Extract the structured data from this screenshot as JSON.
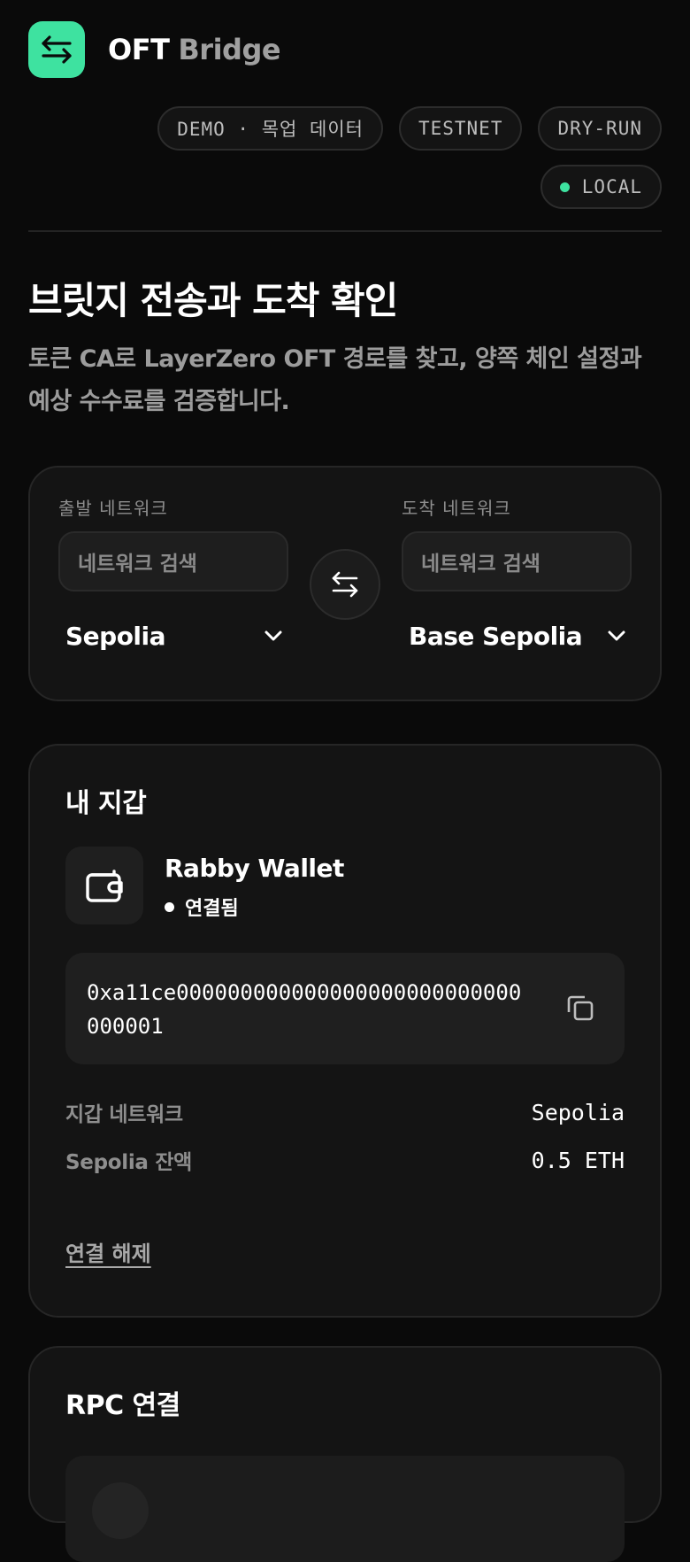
{
  "header": {
    "brand_primary": "OFT",
    "brand_secondary": "Bridge",
    "accent_color": "#3ee2a0"
  },
  "badges": [
    {
      "label": "DEMO · 목업 데이터"
    },
    {
      "label": "TESTNET"
    },
    {
      "label": "DRY-RUN"
    },
    {
      "label": "LOCAL",
      "indicator": "dot-green"
    }
  ],
  "hero": {
    "title": "브릿지 전송과 도착 확인",
    "subtitle": "토큰 CA로 LayerZero OFT 경로를 찾고, 양쪽 체인 설정과 예상 수수료를 검증합니다."
  },
  "network": {
    "from_label": "출발 네트워크",
    "from_search_placeholder": "네트워크 검색",
    "from_selected": "Sepolia",
    "to_label": "도착 네트워크",
    "to_search_placeholder": "네트워크 검색",
    "to_selected": "Base Sepolia",
    "swap_icon": "swap-arrows-icon"
  },
  "wallet": {
    "title": "내 지갑",
    "provider": "Rabby Wallet",
    "status": "연결됨",
    "address": "0xa11ce000000000000000000000000000000001",
    "network_label": "지갑 네트워크",
    "network_value": "Sepolia",
    "balance_label": "Sepolia 잔액",
    "balance_value": "0.5 ETH",
    "disconnect_label": "연결 해제"
  },
  "rpc": {
    "title": "RPC 연결"
  }
}
